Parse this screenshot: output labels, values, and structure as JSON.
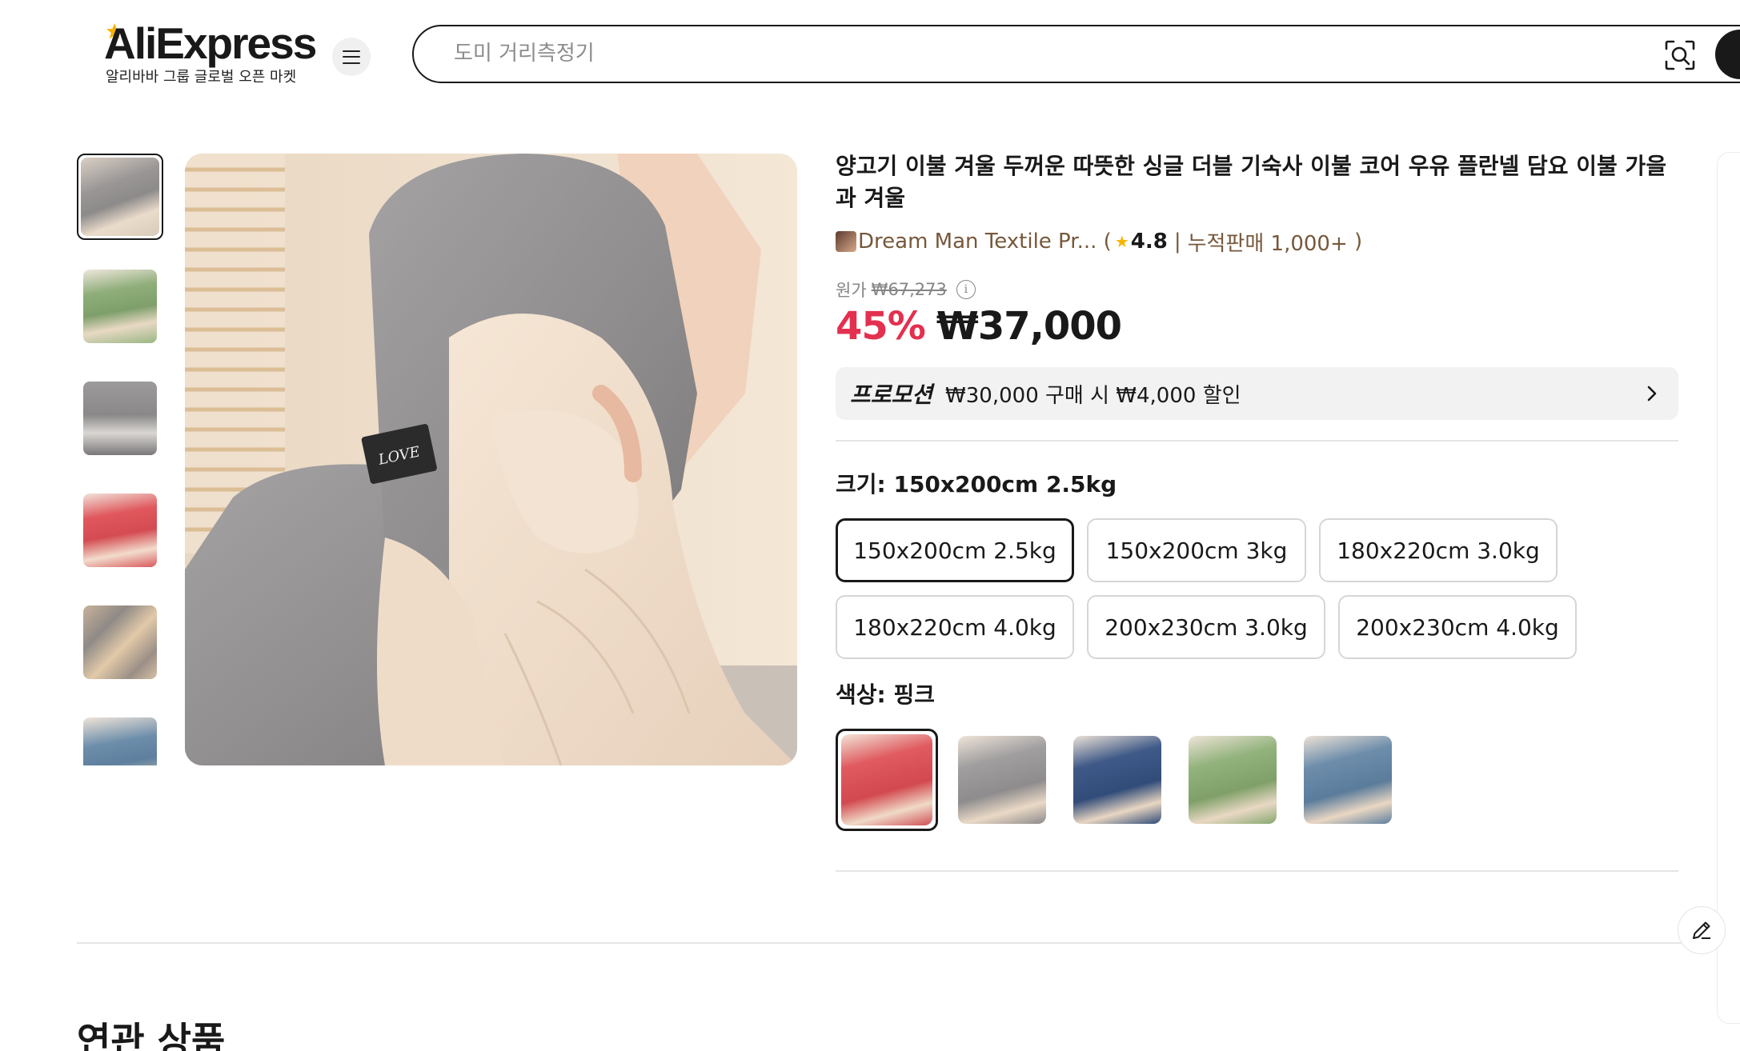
{
  "header": {
    "logo_text": "AliExpress",
    "logo_subtitle": "알리바바 그룹 글로벌 오픈 마켓",
    "search_placeholder": "도미 거리측정기"
  },
  "product": {
    "title": "양고기 이불 겨울 두꺼운 따뜻한 싱글 더블 기숙사 이불 코어 우유 플란넬 담요 이불 가을과 겨울",
    "store_name": "Dream Man Textile Pr...",
    "rating": "4.8",
    "sales": "누적판매 1,000+",
    "original_price_label": "원가",
    "original_price": "₩67,273",
    "discount": "45%",
    "price": "₩37,000",
    "promo_tag": "프로모션",
    "promo_text": "₩30,000 구매 시 ₩4,000 할인",
    "size_label": "크기: 150x200cm 2.5kg",
    "sizes": [
      "150x200cm 2.5kg",
      "150x200cm 3kg",
      "180x220cm 3.0kg",
      "180x220cm 4.0kg",
      "200x230cm 3.0kg",
      "200x230cm 4.0kg"
    ],
    "selected_size_index": 0,
    "color_label": "색상: 핑크",
    "color_swatches": [
      "pink",
      "gray",
      "navy",
      "green",
      "blue"
    ],
    "selected_color_index": 0
  },
  "gallery": {
    "thumbnails": [
      "gray",
      "green",
      "gray-detail",
      "pink",
      "collage",
      "blue"
    ],
    "active_index": 0
  },
  "related": {
    "title": "연관 상품"
  },
  "colors": {
    "discount": "#e3304f",
    "store_link": "#76583a",
    "star": "#f5b400"
  }
}
